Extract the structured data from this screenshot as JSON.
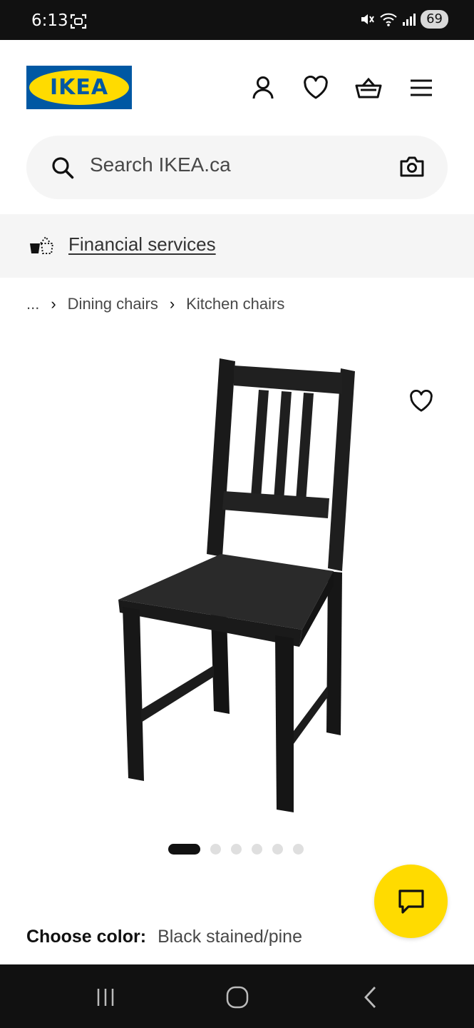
{
  "status_bar": {
    "time": "6:13",
    "battery": "69"
  },
  "header": {
    "logo_text": "IKEA",
    "icons": [
      "account-icon",
      "heart-icon",
      "basket-icon",
      "menu-icon"
    ]
  },
  "search": {
    "placeholder": "Search IKEA.ca"
  },
  "financial_bar": {
    "link_text": "Financial services"
  },
  "breadcrumb": {
    "ellipsis": "...",
    "items": [
      "Dining chairs",
      "Kitchen chairs"
    ]
  },
  "carousel": {
    "image_count": 6,
    "active_index": 0
  },
  "product": {
    "choose_color_label": "Choose color:",
    "color_value": "Black stained/pine"
  },
  "colors": {
    "ikea_blue": "#0058a3",
    "ikea_yellow": "#ffdb00",
    "chair": "#1e1e1e"
  }
}
